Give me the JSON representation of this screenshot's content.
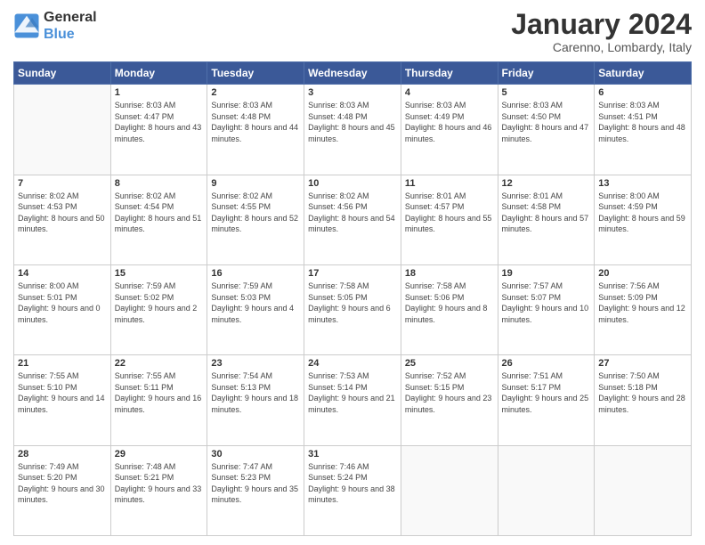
{
  "header": {
    "logo_line1": "General",
    "logo_line2": "Blue",
    "month_title": "January 2024",
    "location": "Carenno, Lombardy, Italy"
  },
  "weekdays": [
    "Sunday",
    "Monday",
    "Tuesday",
    "Wednesday",
    "Thursday",
    "Friday",
    "Saturday"
  ],
  "weeks": [
    [
      {
        "day": "",
        "sunrise": "",
        "sunset": "",
        "daylight": ""
      },
      {
        "day": "1",
        "sunrise": "Sunrise: 8:03 AM",
        "sunset": "Sunset: 4:47 PM",
        "daylight": "Daylight: 8 hours and 43 minutes."
      },
      {
        "day": "2",
        "sunrise": "Sunrise: 8:03 AM",
        "sunset": "Sunset: 4:48 PM",
        "daylight": "Daylight: 8 hours and 44 minutes."
      },
      {
        "day": "3",
        "sunrise": "Sunrise: 8:03 AM",
        "sunset": "Sunset: 4:48 PM",
        "daylight": "Daylight: 8 hours and 45 minutes."
      },
      {
        "day": "4",
        "sunrise": "Sunrise: 8:03 AM",
        "sunset": "Sunset: 4:49 PM",
        "daylight": "Daylight: 8 hours and 46 minutes."
      },
      {
        "day": "5",
        "sunrise": "Sunrise: 8:03 AM",
        "sunset": "Sunset: 4:50 PM",
        "daylight": "Daylight: 8 hours and 47 minutes."
      },
      {
        "day": "6",
        "sunrise": "Sunrise: 8:03 AM",
        "sunset": "Sunset: 4:51 PM",
        "daylight": "Daylight: 8 hours and 48 minutes."
      }
    ],
    [
      {
        "day": "7",
        "sunrise": "Sunrise: 8:02 AM",
        "sunset": "Sunset: 4:53 PM",
        "daylight": "Daylight: 8 hours and 50 minutes."
      },
      {
        "day": "8",
        "sunrise": "Sunrise: 8:02 AM",
        "sunset": "Sunset: 4:54 PM",
        "daylight": "Daylight: 8 hours and 51 minutes."
      },
      {
        "day": "9",
        "sunrise": "Sunrise: 8:02 AM",
        "sunset": "Sunset: 4:55 PM",
        "daylight": "Daylight: 8 hours and 52 minutes."
      },
      {
        "day": "10",
        "sunrise": "Sunrise: 8:02 AM",
        "sunset": "Sunset: 4:56 PM",
        "daylight": "Daylight: 8 hours and 54 minutes."
      },
      {
        "day": "11",
        "sunrise": "Sunrise: 8:01 AM",
        "sunset": "Sunset: 4:57 PM",
        "daylight": "Daylight: 8 hours and 55 minutes."
      },
      {
        "day": "12",
        "sunrise": "Sunrise: 8:01 AM",
        "sunset": "Sunset: 4:58 PM",
        "daylight": "Daylight: 8 hours and 57 minutes."
      },
      {
        "day": "13",
        "sunrise": "Sunrise: 8:00 AM",
        "sunset": "Sunset: 4:59 PM",
        "daylight": "Daylight: 8 hours and 59 minutes."
      }
    ],
    [
      {
        "day": "14",
        "sunrise": "Sunrise: 8:00 AM",
        "sunset": "Sunset: 5:01 PM",
        "daylight": "Daylight: 9 hours and 0 minutes."
      },
      {
        "day": "15",
        "sunrise": "Sunrise: 7:59 AM",
        "sunset": "Sunset: 5:02 PM",
        "daylight": "Daylight: 9 hours and 2 minutes."
      },
      {
        "day": "16",
        "sunrise": "Sunrise: 7:59 AM",
        "sunset": "Sunset: 5:03 PM",
        "daylight": "Daylight: 9 hours and 4 minutes."
      },
      {
        "day": "17",
        "sunrise": "Sunrise: 7:58 AM",
        "sunset": "Sunset: 5:05 PM",
        "daylight": "Daylight: 9 hours and 6 minutes."
      },
      {
        "day": "18",
        "sunrise": "Sunrise: 7:58 AM",
        "sunset": "Sunset: 5:06 PM",
        "daylight": "Daylight: 9 hours and 8 minutes."
      },
      {
        "day": "19",
        "sunrise": "Sunrise: 7:57 AM",
        "sunset": "Sunset: 5:07 PM",
        "daylight": "Daylight: 9 hours and 10 minutes."
      },
      {
        "day": "20",
        "sunrise": "Sunrise: 7:56 AM",
        "sunset": "Sunset: 5:09 PM",
        "daylight": "Daylight: 9 hours and 12 minutes."
      }
    ],
    [
      {
        "day": "21",
        "sunrise": "Sunrise: 7:55 AM",
        "sunset": "Sunset: 5:10 PM",
        "daylight": "Daylight: 9 hours and 14 minutes."
      },
      {
        "day": "22",
        "sunrise": "Sunrise: 7:55 AM",
        "sunset": "Sunset: 5:11 PM",
        "daylight": "Daylight: 9 hours and 16 minutes."
      },
      {
        "day": "23",
        "sunrise": "Sunrise: 7:54 AM",
        "sunset": "Sunset: 5:13 PM",
        "daylight": "Daylight: 9 hours and 18 minutes."
      },
      {
        "day": "24",
        "sunrise": "Sunrise: 7:53 AM",
        "sunset": "Sunset: 5:14 PM",
        "daylight": "Daylight: 9 hours and 21 minutes."
      },
      {
        "day": "25",
        "sunrise": "Sunrise: 7:52 AM",
        "sunset": "Sunset: 5:15 PM",
        "daylight": "Daylight: 9 hours and 23 minutes."
      },
      {
        "day": "26",
        "sunrise": "Sunrise: 7:51 AM",
        "sunset": "Sunset: 5:17 PM",
        "daylight": "Daylight: 9 hours and 25 minutes."
      },
      {
        "day": "27",
        "sunrise": "Sunrise: 7:50 AM",
        "sunset": "Sunset: 5:18 PM",
        "daylight": "Daylight: 9 hours and 28 minutes."
      }
    ],
    [
      {
        "day": "28",
        "sunrise": "Sunrise: 7:49 AM",
        "sunset": "Sunset: 5:20 PM",
        "daylight": "Daylight: 9 hours and 30 minutes."
      },
      {
        "day": "29",
        "sunrise": "Sunrise: 7:48 AM",
        "sunset": "Sunset: 5:21 PM",
        "daylight": "Daylight: 9 hours and 33 minutes."
      },
      {
        "day": "30",
        "sunrise": "Sunrise: 7:47 AM",
        "sunset": "Sunset: 5:23 PM",
        "daylight": "Daylight: 9 hours and 35 minutes."
      },
      {
        "day": "31",
        "sunrise": "Sunrise: 7:46 AM",
        "sunset": "Sunset: 5:24 PM",
        "daylight": "Daylight: 9 hours and 38 minutes."
      },
      {
        "day": "",
        "sunrise": "",
        "sunset": "",
        "daylight": ""
      },
      {
        "day": "",
        "sunrise": "",
        "sunset": "",
        "daylight": ""
      },
      {
        "day": "",
        "sunrise": "",
        "sunset": "",
        "daylight": ""
      }
    ]
  ]
}
